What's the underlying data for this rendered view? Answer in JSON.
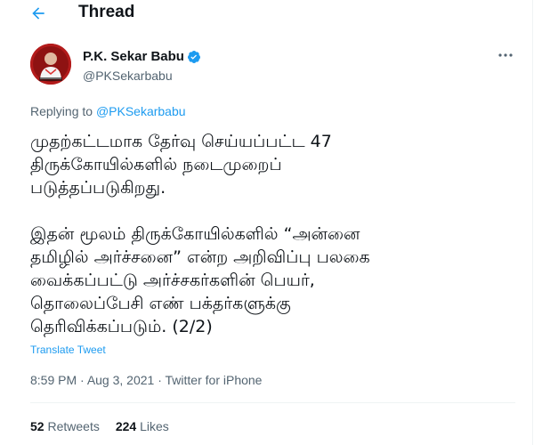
{
  "header": {
    "title": "Thread",
    "back_icon": "arrow-left-icon"
  },
  "author": {
    "display_name": "P.K. Sekar Babu",
    "handle": "@PKSekarbabu",
    "verified_icon": "verified-badge-icon",
    "more_icon": "more-horizontal-icon"
  },
  "replying": {
    "prefix": "Replying to ",
    "handle": "@PKSekarbabu"
  },
  "tweet": {
    "text": "முதற்கட்டமாக தேர்வு செய்யப்பட்ட 47\nதிருக்கோயில்களில் நடைமுறைப்\nபடுத்தப்படுகிறது.\n\nஇதன் மூலம் திருக்கோயில்களில் “அன்னை\nதமிழில் அர்ச்சனை” என்ற அறிவிப்பு பலகை\nவைக்கப்பட்டு அர்ச்சகர்களின் பெயர்,\nதொலைப்பேசி எண் பக்தர்களுக்கு\nதெரிவிக்கப்படும். (2/2)",
    "translate_label": "Translate Tweet"
  },
  "meta": {
    "time": "8:59 PM",
    "sep1": " · ",
    "date": "Aug 3, 2021",
    "sep2": " · ",
    "source": "Twitter for iPhone"
  },
  "stats": {
    "retweets_count": "52",
    "retweets_label": "Retweets",
    "likes_count": "224",
    "likes_label": "Likes"
  },
  "colors": {
    "accent": "#1d9bf0",
    "text_primary": "#0f1419",
    "text_secondary": "#536471",
    "divider": "#eff3f4"
  }
}
